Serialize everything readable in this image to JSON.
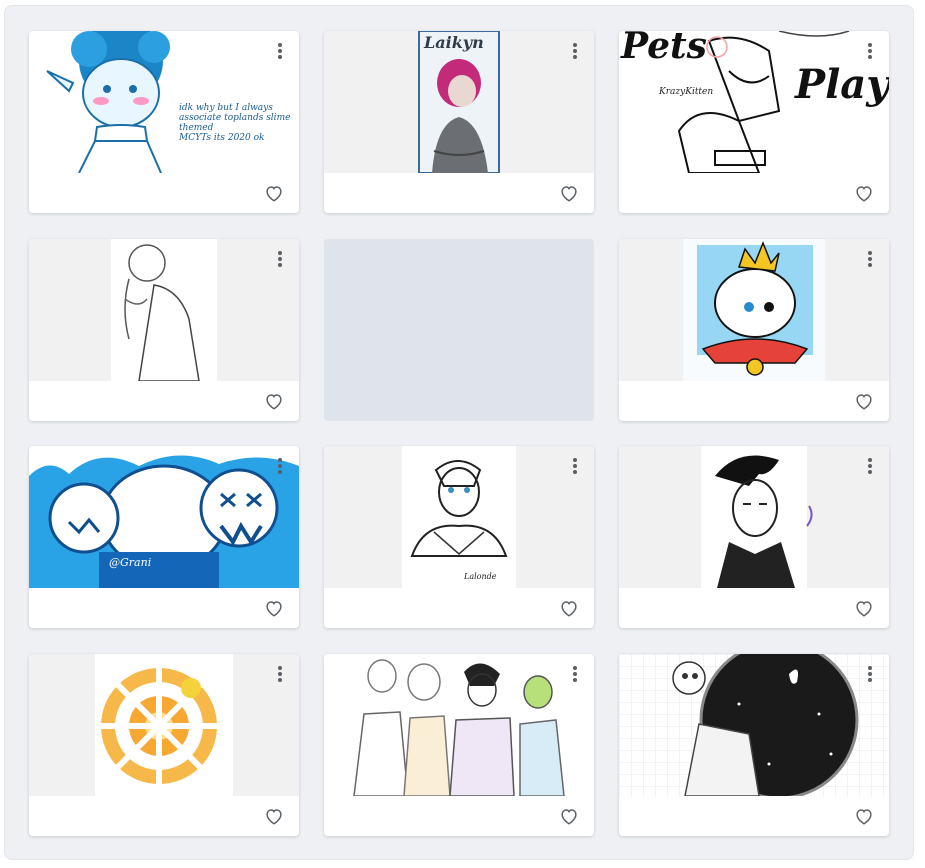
{
  "gallery": {
    "cards": [
      {
        "id": "art-1",
        "art_text": "idk why but I always\nassociate toplands slime themed\nMCYTs its 2020 ok",
        "art_text_color": "#1a5d8f"
      },
      {
        "id": "art-2",
        "art_text": "Laikyn"
      },
      {
        "id": "art-3",
        "art_text": "Play!",
        "art_text_2": "Pets",
        "signature": "KrazyKitten"
      },
      {
        "id": "art-4"
      },
      {
        "id": "art-5",
        "placeholder": true
      },
      {
        "id": "art-6"
      },
      {
        "id": "art-7",
        "art_text": "@Grani"
      },
      {
        "id": "art-8",
        "signature": "Lalonde"
      },
      {
        "id": "art-9"
      },
      {
        "id": "art-10"
      },
      {
        "id": "art-11"
      },
      {
        "id": "art-12"
      }
    ],
    "icons": {
      "favorite": "heart-outline-icon",
      "more": "more-vertical-icon"
    }
  },
  "colors": {
    "panel_bg": "#eef0f3",
    "card_bg": "#ffffff",
    "placeholder_bg": "#dfe4ea",
    "icon": "#5a5f66"
  }
}
